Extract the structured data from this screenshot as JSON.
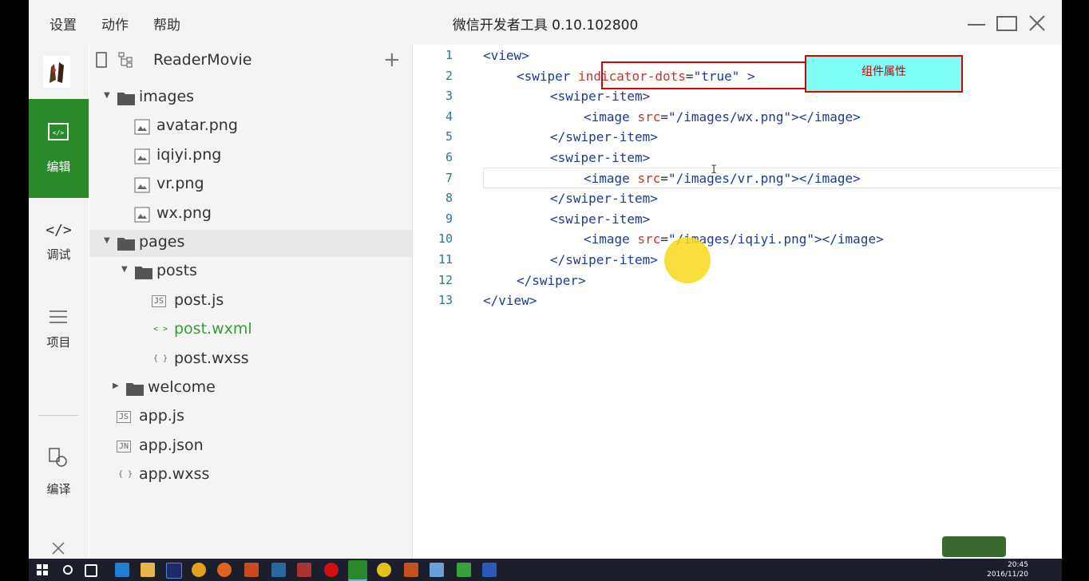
{
  "menu": [
    "设置",
    "动作",
    "帮助"
  ],
  "window_title": "微信开发者工具 0.10.102800",
  "sidebar": [
    {
      "label": "编辑",
      "icon": "code-icon",
      "active": true
    },
    {
      "label": "调试",
      "icon": "debug-icon",
      "active": false
    },
    {
      "label": "项目",
      "icon": "menu-icon",
      "active": false
    },
    {
      "label": "编译",
      "icon": "compile-icon",
      "active": false
    }
  ],
  "project_name": "ReaderMovie",
  "tree": [
    {
      "name": "images",
      "type": "folder",
      "level": 0,
      "expanded": true
    },
    {
      "name": "avatar.png",
      "type": "image",
      "level": 1
    },
    {
      "name": "iqiyi.png",
      "type": "image",
      "level": 1
    },
    {
      "name": "vr.png",
      "type": "image",
      "level": 1
    },
    {
      "name": "wx.png",
      "type": "image",
      "level": 1
    },
    {
      "name": "pages",
      "type": "folder",
      "level": 0,
      "expanded": true,
      "selected": true
    },
    {
      "name": "posts",
      "type": "folder",
      "level": 1,
      "expanded": true
    },
    {
      "name": "post.js",
      "type": "js",
      "level": 2,
      "badge": "JS"
    },
    {
      "name": "post.wxml",
      "type": "wxml",
      "level": 2,
      "badge": "< >",
      "active": true
    },
    {
      "name": "post.wxss",
      "type": "wxss",
      "level": 2,
      "badge": "{ }"
    },
    {
      "name": "welcome",
      "type": "folder",
      "level": 0.5,
      "expanded": false
    },
    {
      "name": "app.js",
      "type": "js",
      "level": 0,
      "badge": "JS"
    },
    {
      "name": "app.json",
      "type": "json",
      "level": 0,
      "badge": "JN"
    },
    {
      "name": "app.wxss",
      "type": "wxss",
      "level": 0,
      "badge": "{ }"
    }
  ],
  "code_lines": [
    {
      "n": "1",
      "indent": 0,
      "tokens": [
        [
          "tag",
          "<view>"
        ]
      ]
    },
    {
      "n": "2",
      "indent": 1,
      "tokens": [
        [
          "tag",
          "<swiper "
        ],
        [
          "attr",
          "indicator-dots"
        ],
        [
          "txt",
          "="
        ],
        [
          "str",
          "\"true\""
        ],
        [
          "tag",
          " >"
        ]
      ]
    },
    {
      "n": "3",
      "indent": 2,
      "tokens": [
        [
          "tag",
          "<swiper-item>"
        ]
      ]
    },
    {
      "n": "4",
      "indent": 3,
      "tokens": [
        [
          "tag",
          "<image "
        ],
        [
          "attr",
          "src"
        ],
        [
          "txt",
          "="
        ],
        [
          "str",
          "\"/images/wx.png\""
        ],
        [
          "tag",
          "></image>"
        ]
      ]
    },
    {
      "n": "5",
      "indent": 2,
      "tokens": [
        [
          "tag",
          "</swiper-item>"
        ]
      ]
    },
    {
      "n": "6",
      "indent": 2,
      "tokens": [
        [
          "tag",
          "<swiper-item>"
        ]
      ]
    },
    {
      "n": "7",
      "indent": 3,
      "tokens": [
        [
          "tag",
          "<image "
        ],
        [
          "attr",
          "src"
        ],
        [
          "txt",
          "="
        ],
        [
          "str",
          "\"/images/vr.png\""
        ],
        [
          "tag",
          "></image>"
        ]
      ]
    },
    {
      "n": "8",
      "indent": 2,
      "tokens": [
        [
          "tag",
          "</swiper-item>"
        ]
      ]
    },
    {
      "n": "9",
      "indent": 2,
      "tokens": [
        [
          "tag",
          "<swiper-item>"
        ]
      ]
    },
    {
      "n": "10",
      "indent": 3,
      "tokens": [
        [
          "tag",
          "<image "
        ],
        [
          "attr",
          "src"
        ],
        [
          "txt",
          "="
        ],
        [
          "str",
          "\"/images/iqiyi.png\""
        ],
        [
          "tag",
          "></image>"
        ]
      ]
    },
    {
      "n": "11",
      "indent": 2,
      "tokens": [
        [
          "tag",
          "</swiper-item>"
        ]
      ]
    },
    {
      "n": "12",
      "indent": 1,
      "tokens": [
        [
          "tag",
          "</swiper>"
        ]
      ]
    },
    {
      "n": "13",
      "indent": 0,
      "tokens": [
        [
          "tag",
          "</view>"
        ]
      ]
    }
  ],
  "annotation_label": "组件属性",
  "clock": {
    "time": "20:45",
    "date": "2016/11/20"
  },
  "colors": {
    "accent": "#2a8a2a",
    "tooltip_bg": "#7ffff7",
    "highlight_border": "#d00000"
  }
}
